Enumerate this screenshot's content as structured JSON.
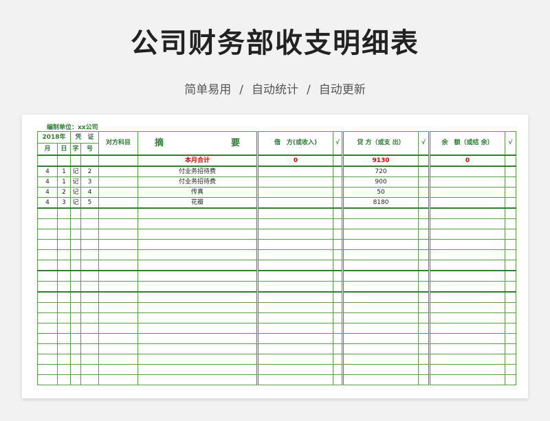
{
  "title": "公司财务部收支明细表",
  "subtitle": [
    "简单易用",
    "自动统计",
    "自动更新"
  ],
  "subtitle_sep": "/",
  "unit_label": "编制单位：xx公司",
  "header": {
    "year": "2018年",
    "voucher": "凭　证",
    "month": "月",
    "day": "日",
    "zi": "字",
    "hao": "号",
    "account": "对方科目",
    "summary": "摘　　要",
    "debit": "借　方(或收入)",
    "check1": "√",
    "credit": "贷 方（或支 出）",
    "check2": "√",
    "balance": "余　额（或结 余）",
    "check3": "√"
  },
  "total": {
    "label": "本月合计",
    "debit": "0",
    "credit": "9130",
    "balance": "0"
  },
  "rows": [
    {
      "month": "4",
      "day": "1",
      "zi": "记",
      "hao": "2",
      "summary": "付业务招待费",
      "credit": "720"
    },
    {
      "month": "4",
      "day": "1",
      "zi": "记",
      "hao": "3",
      "summary": "付业务招待费",
      "credit": "900"
    },
    {
      "month": "4",
      "day": "2",
      "zi": "记",
      "hao": "4",
      "summary": "传真",
      "credit": "50"
    },
    {
      "month": "4",
      "day": "3",
      "zi": "记",
      "hao": "5",
      "summary": "花瓣",
      "credit": "8180"
    }
  ]
}
